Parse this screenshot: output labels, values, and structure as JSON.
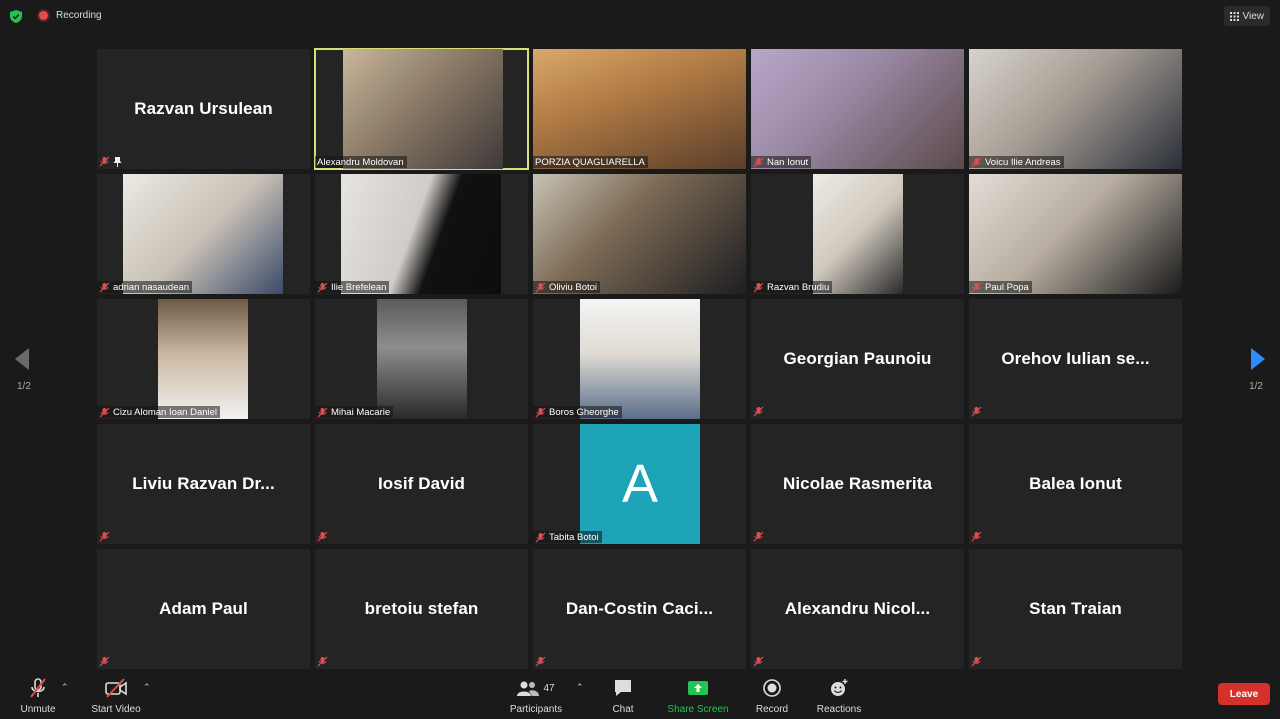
{
  "topbar": {
    "recording_label": "Recording",
    "view_label": "View"
  },
  "pagination": {
    "left_indicator": "1/2",
    "right_indicator": "1/2"
  },
  "participants": [
    {
      "name": "Razvan Ursulean",
      "caption": "",
      "display": "name",
      "pinned": true
    },
    {
      "name": "Alexandru Moldovan",
      "caption": "Alexandru Moldovan",
      "display": "video",
      "speaking": true
    },
    {
      "name": "PORZIA QUAGLIARELLA",
      "caption": "PORZIA QUAGLIARELLA",
      "display": "video"
    },
    {
      "name": "Nan Ionut",
      "caption": "Nan Ionut",
      "display": "video"
    },
    {
      "name": "Voicu Ilie  Andreas",
      "caption": "Voicu Ilie  Andreas",
      "display": "video"
    },
    {
      "name": "adrian nasaudean",
      "caption": "adrian nasaudean",
      "display": "video"
    },
    {
      "name": "Ilie Brefelean",
      "caption": "Ilie Brefelean",
      "display": "video"
    },
    {
      "name": "Oliviu Botoi",
      "caption": "Oliviu Botoi",
      "display": "video"
    },
    {
      "name": "Razvan Brudiu",
      "caption": "Razvan Brudiu",
      "display": "video"
    },
    {
      "name": "Paul Popa",
      "caption": "Paul Popa",
      "display": "video"
    },
    {
      "name": "Cizu Aloman Ioan Daniel",
      "caption": "Cizu Aloman Ioan Daniel",
      "display": "video"
    },
    {
      "name": "Mihai Macarie",
      "caption": "Mihai Macarie",
      "display": "video"
    },
    {
      "name": "Boros Gheorghe",
      "caption": "Boros Gheorghe",
      "display": "video"
    },
    {
      "name": "Georgian Paunoiu",
      "caption": "",
      "display": "name"
    },
    {
      "name": "Orehov  Iulian  se...",
      "caption": "",
      "display": "name"
    },
    {
      "name": "Liviu  Razvan  Dr...",
      "caption": "",
      "display": "name"
    },
    {
      "name": "Iosif David",
      "caption": "",
      "display": "name"
    },
    {
      "name": "Tabita Botoi",
      "caption": "Tabita Botoi",
      "display": "avatar",
      "avatar_letter": "A"
    },
    {
      "name": "Nicolae Rasmerita",
      "caption": "",
      "display": "name"
    },
    {
      "name": "Balea Ionut",
      "caption": "",
      "display": "name"
    },
    {
      "name": "Adam Paul",
      "caption": "",
      "display": "name"
    },
    {
      "name": "bretoiu stefan",
      "caption": "",
      "display": "name"
    },
    {
      "name": "Dan-Costin  Caci...",
      "caption": "",
      "display": "name"
    },
    {
      "name": "Alexandru  Nicol...",
      "caption": "",
      "display": "name"
    },
    {
      "name": "Stan Traian",
      "caption": "",
      "display": "name"
    }
  ],
  "toolbar": {
    "unmute_label": "Unmute",
    "start_video_label": "Start Video",
    "participants_label": "Participants",
    "participants_count": "47",
    "chat_label": "Chat",
    "share_screen_label": "Share Screen",
    "record_label": "Record",
    "reactions_label": "Reactions",
    "leave_label": "Leave"
  },
  "colors": {
    "background": "#1a1a1a",
    "tile": "#242424",
    "speaking_outline": "#d6e077",
    "share_green": "#23c552",
    "leave_red": "#d7302a",
    "avatar_teal": "#1ca3b5",
    "arrow_blue": "#2d8cff"
  }
}
